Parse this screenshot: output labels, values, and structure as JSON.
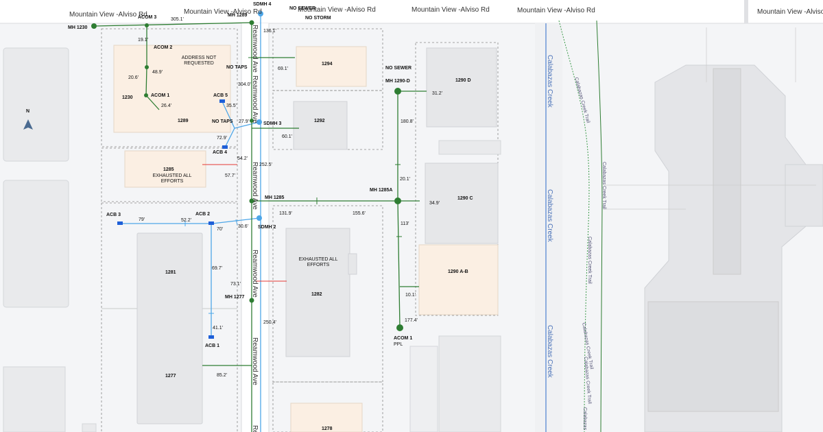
{
  "roads": {
    "mountain_view": [
      "Mountain View -Alviso Rd",
      "Mountain View -Alviso Rd",
      "Mountain View -Alviso Rd",
      "Mountain View -Alviso Rd",
      "Mountain View -Alviso Rd",
      "Mountain View -Alviso Rd"
    ],
    "reamwood": [
      "Reamwood Ave",
      "Reamwood Ave",
      "Reamwood Ave",
      "Reamwood Ave",
      "Reamwood Ave",
      "Re"
    ]
  },
  "creek": [
    "Calabazas Creek",
    "Calabazas Creek",
    "Calabazas Creek"
  ],
  "trail": [
    "Calabazas Creek Trail",
    "Calabazas Creek Trail",
    "Calabazas Creek Trail",
    "Calabazas Creek Trail",
    "Calabazas Creek Trail",
    "Calabazas"
  ],
  "north_arrow": "N",
  "buildings": {
    "b1230": "1230",
    "b1289": "1289",
    "b1285": "1285",
    "b1285_note": "EXHAUSTED ALL EFFORTS",
    "b1281": "1281",
    "b1277": "1277",
    "b1294": "1294",
    "b1292": "1292",
    "b1282": "1282",
    "b1282_note": "EXHAUSTED ALL EFFORTS",
    "b1278": "1278",
    "b1290d": "1290 D",
    "b1290c": "1290 C",
    "b1290ab": "1290 A-B",
    "address_note": "ADDRESS NOT REQUESTED"
  },
  "structures": {
    "mh1230": "MH 1230",
    "mh1289": "MH 1289",
    "sdmh4": "SDMH 4",
    "sdmh3": "SDMH 3",
    "sdmh2": "SDMH 2",
    "mh1285": "MH 1285",
    "mh1277": "MH 1277",
    "mh1290d": "MH 1290-D",
    "mh1285a": "MH 1285A",
    "acom3": "ACOM 3",
    "acom2": "ACOM 2",
    "acom1": "ACOM 1",
    "acom1ppl": "ACOM 1",
    "ppl": "PPL",
    "acb5": "ACB 5",
    "acb4": "ACB 4",
    "acb3": "ACB 3",
    "acb2": "ACB 2",
    "acb1": "ACB 1"
  },
  "notes": {
    "no_sewer_top": "NO SEWER",
    "no_storm": "NO STORM",
    "no_taps_1": "NO TAPS",
    "no_taps_2": "NO TAPS",
    "no_sewer_right": "NO SEWER"
  },
  "lengths": {
    "l305": "305.1'",
    "l136": "136.1'",
    "l19": "19.1'",
    "l48": "48.9'",
    "l20_6": "20.6'",
    "l26": "26.4'",
    "l304": "304.0'",
    "l69": "69.1'",
    "l35": "35.5'",
    "l27": "27.9'",
    "l72": "72.9'",
    "l60": "60.1'",
    "l54": "54.2'",
    "l252": "252.5'",
    "l57": "57.7'",
    "l131": "131.9'",
    "l155": "155.6'",
    "l79": "79'",
    "l52": "52.2'",
    "l70": "70'",
    "l30": "30.6'",
    "l69_7": "69.7'",
    "l73": "73.1'",
    "l41": "41.1'",
    "l250": "250.4'",
    "l85": "85.2'",
    "l31": "31.2'",
    "l180": "180.8'",
    "l20_1": "20.1'",
    "l34": "34.9'",
    "l113": "113'",
    "l10": "10.1'",
    "l177": "177.4'"
  },
  "colors": {
    "sewer": "#2e7d32",
    "storm": "#4da6e8",
    "conflict": "#e53935",
    "background": "#f4f5f7",
    "road": "#ffffff",
    "building": "#ececee",
    "building_highlight": "#fbefe3",
    "creek": "#4a72b8"
  }
}
